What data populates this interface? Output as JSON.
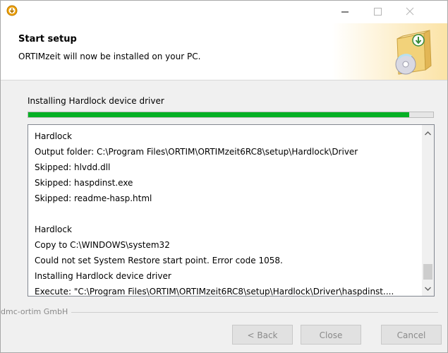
{
  "window": {
    "title": ""
  },
  "header": {
    "title": "Start setup",
    "subtitle": "ORTIMzeit will now be installed on your PC."
  },
  "status": {
    "text": "Installing Hardlock device driver",
    "progress_percent": 94
  },
  "log": {
    "lines": [
      "Hardlock",
      "Output folder: C:\\Program Files\\ORTIM\\ORTIMzeit6RC8\\setup\\Hardlock\\Driver",
      "Skipped: hlvdd.dll",
      "Skipped: haspdinst.exe",
      "Skipped: readme-hasp.html",
      "",
      "Hardlock",
      "Copy to C:\\WINDOWS\\system32",
      "Could not set System Restore start point. Error code 1058.",
      "Installing Hardlock device driver",
      "Execute: \"C:\\Program Files\\ORTIM\\ORTIMzeit6RC8\\setup\\Hardlock\\Driver\\haspdinst...."
    ]
  },
  "footer": {
    "brand": "dmc-ortim GmbH",
    "back_label": "< Back",
    "close_label": "Close",
    "cancel_label": "Cancel"
  },
  "icons": {
    "app": "installer-icon",
    "minimize": "minimize-icon",
    "maximize": "maximize-icon",
    "close": "close-icon",
    "header_art": "cd-box-icon"
  },
  "colors": {
    "progress": "#06b025"
  }
}
